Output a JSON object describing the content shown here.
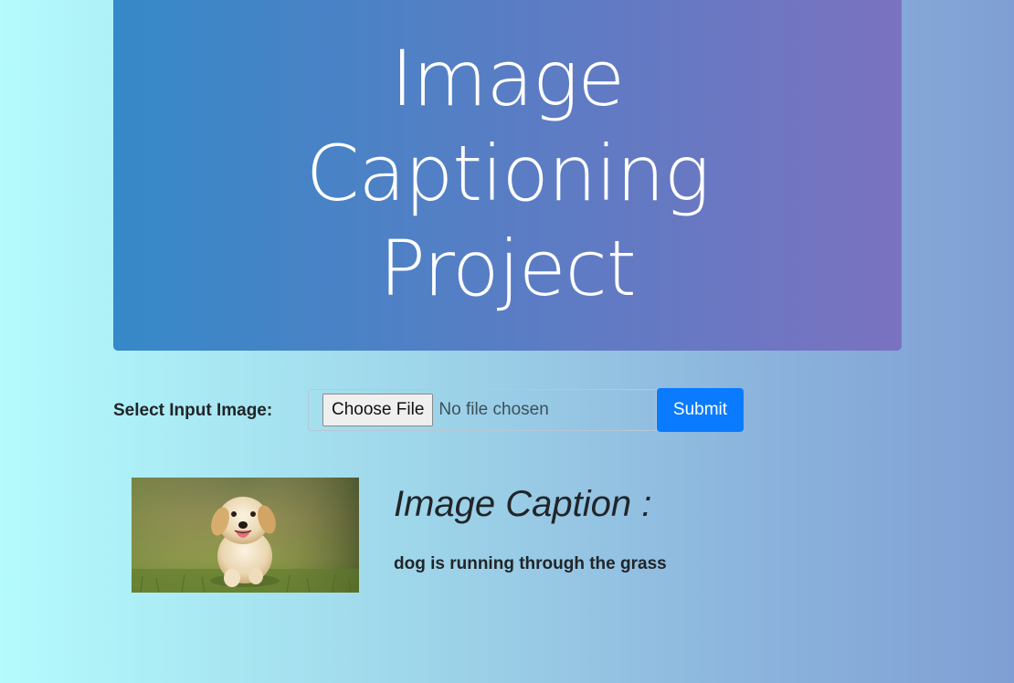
{
  "header": {
    "title": "Image Captioning Project"
  },
  "upload": {
    "label": "Select Input Image:",
    "choose_button": "Choose File",
    "file_status": "No file chosen",
    "submit_label": "Submit"
  },
  "result": {
    "image_subject": "puppy running on grass",
    "caption_heading": "Image Caption :",
    "caption_text": "dog is running through the grass"
  },
  "colors": {
    "hero_gradient_start": "#3689c8",
    "hero_gradient_end": "#7a72c0",
    "submit_button": "#0a7bff",
    "page_background_start": "#b4fbfd",
    "page_background_end": "#7f9fd4"
  }
}
